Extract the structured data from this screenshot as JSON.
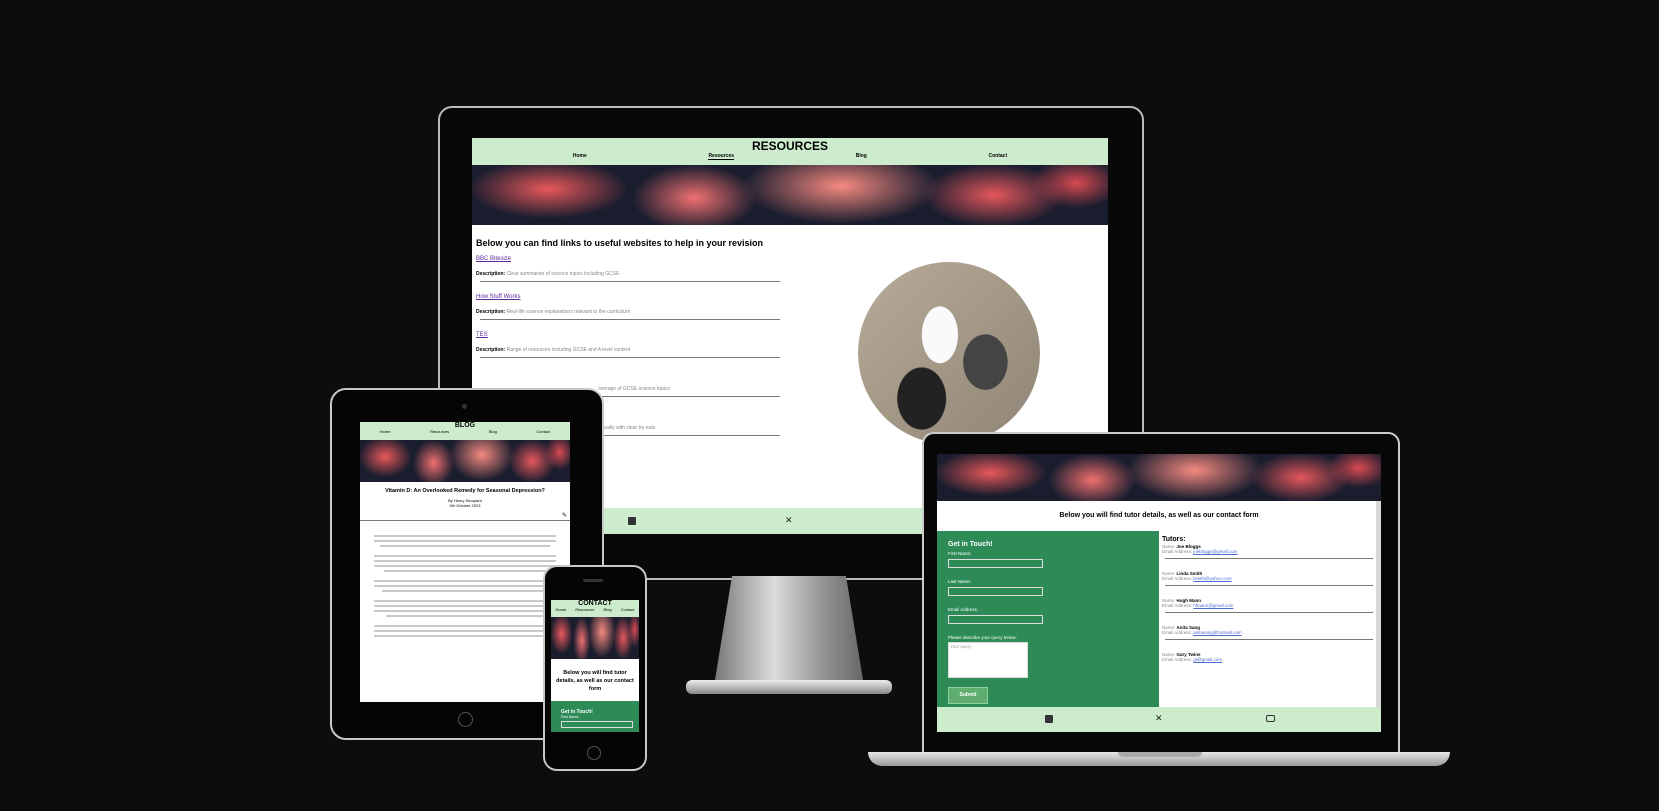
{
  "desktop": {
    "page_title": "RESOURCES",
    "nav": [
      "Home",
      "Resources",
      "Blog",
      "Contact"
    ],
    "heading": "Below you can find links to useful websites to help in your revision",
    "description_label": "Description:",
    "resources": [
      {
        "title": "BBC Bitesize",
        "desc": "Clear summaries of science topics including GCSE"
      },
      {
        "title": "How Stuff Works",
        "desc": "Real-life science explanations relevant to the curriculum"
      },
      {
        "title": "TES",
        "desc": "Range of resources including GCSE and A level content"
      },
      {
        "title": "",
        "desc": "overage of GCSE science topics"
      },
      {
        "title": "",
        "desc": "pecially with clear try-outs"
      }
    ],
    "footer_icons": [
      "facebook-icon",
      "x-twitter-icon"
    ]
  },
  "tablet": {
    "page_title": "BLOG",
    "nav": [
      "Home",
      "Resources",
      "Blog",
      "Contact"
    ],
    "post_title": "Vitamin D: An Overlooked Remedy for Seasonal Depression?",
    "author": "By Henry Stoopard",
    "date": "5th October 2023"
  },
  "phone": {
    "page_title": "CONTACT",
    "nav": [
      "Home",
      "Resources",
      "Blog",
      "Contact"
    ],
    "intro": "Below you will find tutor details, as well as our contact form",
    "form_title": "Get in Touch!",
    "first_name_label": "First Name:"
  },
  "laptop": {
    "intro": "Below you will find tutor details, as well as our contact form",
    "form": {
      "title": "Get in Touch!",
      "first_name": "First Name:",
      "last_name": "Last Name:",
      "email": "Email Address:",
      "query": "Please describe your query below:",
      "query_placeholder": "Your query",
      "submit": "Submit"
    },
    "tutors_title": "Tutors:",
    "name_label": "Name:",
    "email_label": "Email Address:",
    "tutors": [
      {
        "name": "Joe Bloggs",
        "email": "joebloggs@gmail.com"
      },
      {
        "name": "Linda Smith",
        "email": "lsmith@yahoo.com"
      },
      {
        "name": "Hugh Mann",
        "email": "hfmann@gmail.com"
      },
      {
        "name": "Anita Sang",
        "email": "anitasang@hotmail.com"
      },
      {
        "name": "Gary Twine",
        "email": "gt@gmail.com"
      }
    ],
    "footer_icons": [
      "facebook-icon",
      "x-twitter-icon",
      "youtube-icon"
    ]
  },
  "colors": {
    "nav_bg": "#cdeccd",
    "form_green": "#2e8b57",
    "link": "#5a2a9a",
    "background": "#0d0d0d"
  }
}
